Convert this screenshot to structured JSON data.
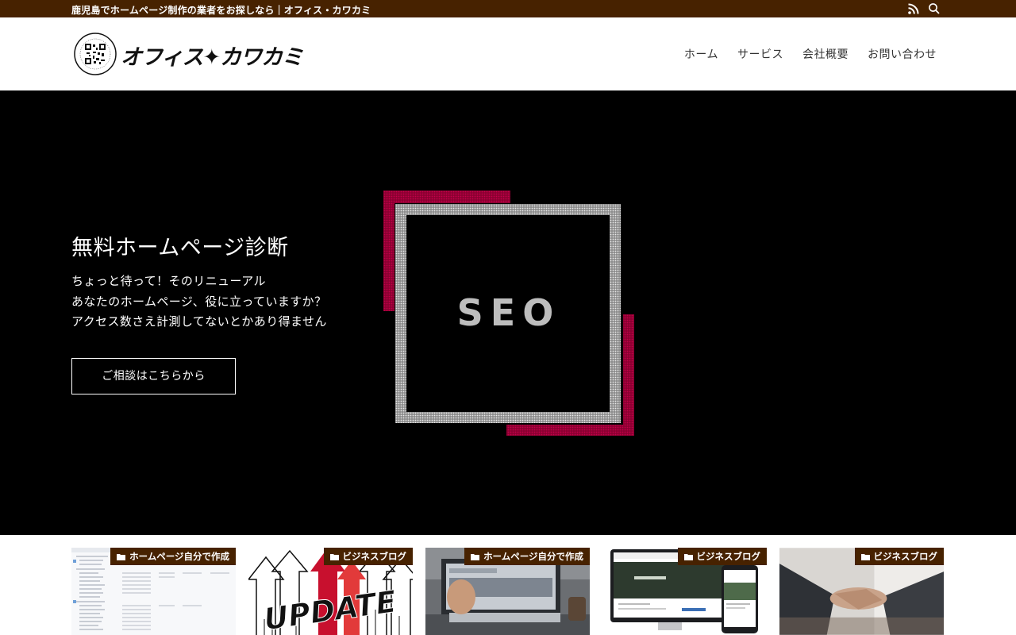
{
  "topbar": {
    "tagline": "鹿児島でホームページ制作の業者をお探しなら｜オフィス・カワカミ",
    "rss_icon": "rss-icon",
    "search_icon": "search-icon"
  },
  "header": {
    "logo_text": "オフィス✦カワカミ",
    "logo_icon": "qr-seal-logo",
    "nav": [
      "ホーム",
      "サービス",
      "会社概要",
      "お問い合わせ"
    ]
  },
  "hero": {
    "title": "無料ホームページ診断",
    "lines": [
      "ちょっと待って！そのリニューアル",
      "あなたのホームページ、役に立っていますか？",
      "アクセス数さえ計測してないとかあり得ません"
    ],
    "cta": "ご相談はこちらから",
    "art_text": "SEO"
  },
  "cards": [
    {
      "category": "ホームページ自分で作成",
      "thumb": "file-list-screenshot"
    },
    {
      "category": "ビジネスブログ",
      "thumb": "update-arrows-image",
      "thumb_text": "UPDATE"
    },
    {
      "category": "ホームページ自分で作成",
      "thumb": "laptop-website-photo"
    },
    {
      "category": "ビジネスブログ",
      "thumb": "responsive-devices-image"
    },
    {
      "category": "ビジネスブログ",
      "thumb": "handshake-photo"
    }
  ],
  "colors": {
    "brand": "#472200",
    "hero_bg": "#000000",
    "accent_red": "#a8003a"
  }
}
